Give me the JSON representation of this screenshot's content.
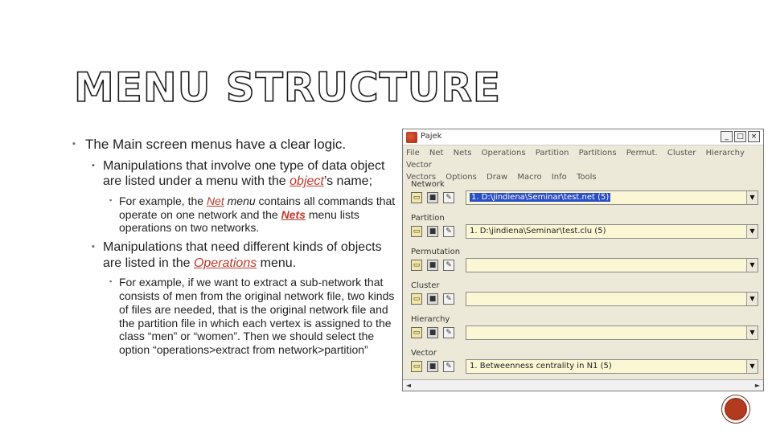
{
  "slide": {
    "title": "MENU STRUCTURE",
    "bullet1": "The Main screen menus have a clear logic.",
    "bullet2a": {
      "text1": "Manipulations that involve one type of data object are listed under a menu with the ",
      "hl": "object",
      "text2": "’s name;"
    },
    "bullet3a": {
      "text1": "For example, the ",
      "net": "Net",
      "text2": " menu",
      "text3": " contains all commands that operate on one network and the ",
      "nets": "Nets",
      "text4": " menu lists operations on two networks."
    },
    "bullet2b": {
      "text1": "Manipulations that need different kinds of objects are listed in the ",
      "hl": "Operations",
      "text2": " menu."
    },
    "bullet3b": "For example, if we want to extract a sub-network that consists of men from the original network file, two kinds of files are needed, that is the original network file and the partition file in which each vertex is assigned to the class “men” or “women”. Then we should select the option “operations>extract from network>partition”"
  },
  "window": {
    "title": "Pajek",
    "controls": [
      "_",
      "□",
      "×"
    ],
    "menu_row1": [
      "File",
      "Net",
      "Nets",
      "Operations",
      "Partition",
      "Partitions",
      "Permut.",
      "Cluster",
      "Hierarchy",
      "Vector"
    ],
    "menu_row2": [
      "Vectors",
      "Options",
      "Draw",
      "Macro",
      "Info",
      "Tools"
    ],
    "sections": [
      {
        "label": "Network",
        "value": "1. D:\\jindiena\\Seminar\\test.net (5)",
        "selected": true
      },
      {
        "label": "Partition",
        "value": "1. D:\\jindiena\\Seminar\\test.clu (5)",
        "selected": false
      },
      {
        "label": "Permutation",
        "value": "",
        "selected": false
      },
      {
        "label": "Cluster",
        "value": "",
        "selected": false
      },
      {
        "label": "Hierarchy",
        "value": "",
        "selected": false
      },
      {
        "label": "Vector",
        "value": "1. Betweenness centrality in N1 (5)",
        "selected": false
      }
    ],
    "icons": [
      "open-folder-icon",
      "save-disk-icon",
      "new-file-icon"
    ]
  },
  "colors": {
    "accent_red": "#c0392b",
    "selection_blue": "#2a4dc8",
    "combo_yellow": "#fbf7d5",
    "window_bg": "#ece9d8"
  }
}
